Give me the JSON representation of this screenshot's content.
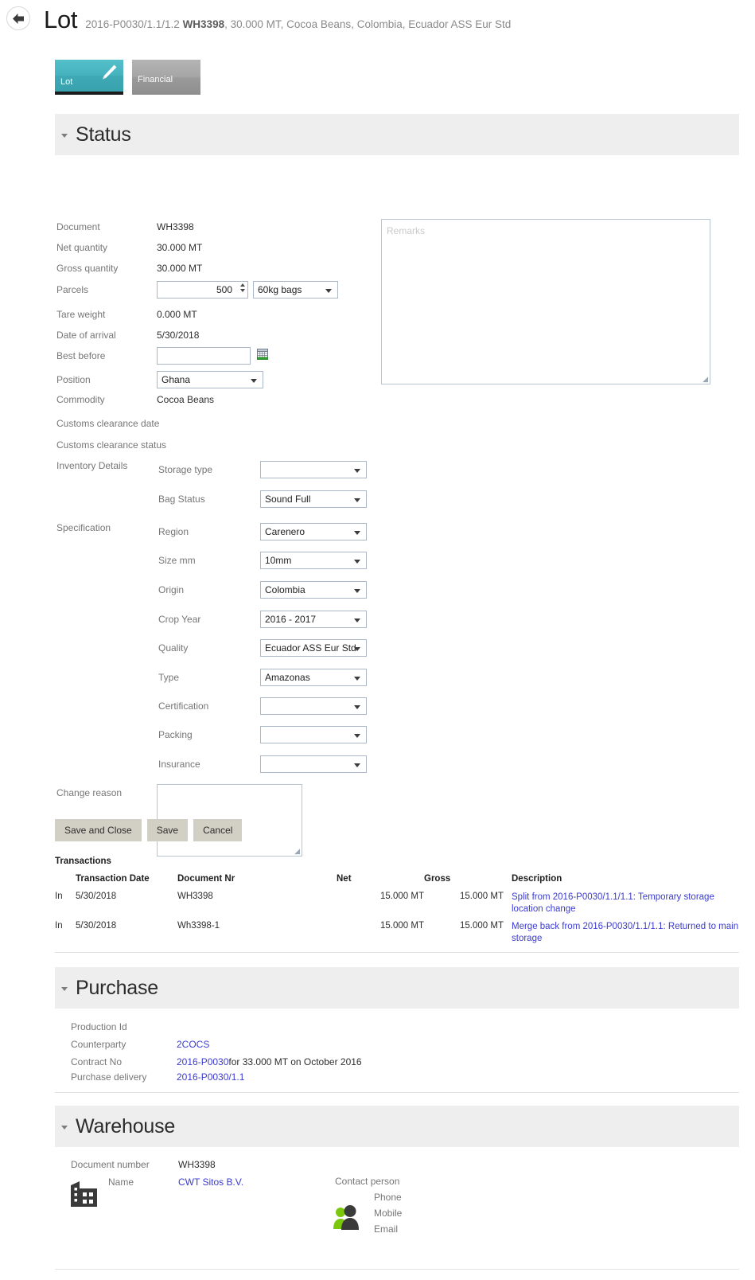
{
  "header": {
    "back_icon": "back-arrow-icon",
    "title": "Lot",
    "subtitle_prefix": "2016-P0030/1.1/1.2 ",
    "subtitle_bold": "WH3398",
    "subtitle_suffix": ", 30.000 MT, Cocoa Beans, Colombia, Ecuador ASS Eur Std"
  },
  "tabs": [
    {
      "label": "Lot",
      "active": true,
      "icon": "pencil-icon",
      "color": "#45b3bf"
    },
    {
      "label": "Financial",
      "active": false,
      "color": "#a0a0a0"
    }
  ],
  "sections": {
    "status": {
      "title": "Status"
    },
    "purchase": {
      "title": "Purchase"
    },
    "warehouse": {
      "title": "Warehouse"
    }
  },
  "status": {
    "document_label": "Document",
    "document_value": "WH3398",
    "net_quantity_label": "Net quantity",
    "net_quantity_value": "30.000 MT",
    "gross_quantity_label": "Gross quantity",
    "gross_quantity_value": "30.000 MT",
    "parcels_label": "Parcels",
    "parcels_value": "500",
    "parcels_unit": "60kg bags",
    "tare_weight_label": "Tare weight",
    "tare_weight_value": "0.000 MT",
    "date_of_arrival_label": "Date of arrival",
    "date_of_arrival_value": "5/30/2018",
    "best_before_label": "Best before",
    "best_before_value": "",
    "position_label": "Position",
    "position_value": "Ghana",
    "commodity_label": "Commodity",
    "commodity_value": "Cocoa Beans",
    "customs_clearance_date_label": "Customs clearance date",
    "customs_clearance_date_value": "",
    "customs_clearance_status_label": "Customs clearance status",
    "customs_clearance_status_value": "",
    "remarks_placeholder": "Remarks",
    "remarks_value": ""
  },
  "inventory_details": {
    "group_label": "Inventory Details",
    "fields": [
      {
        "label": "Storage type",
        "value": ""
      },
      {
        "label": "Bag Status",
        "value": "Sound Full"
      }
    ]
  },
  "specification": {
    "group_label": "Specification",
    "fields": [
      {
        "label": "Region",
        "value": "Carenero"
      },
      {
        "label": "Size mm",
        "value": "10mm"
      },
      {
        "label": "Origin",
        "value": "Colombia"
      },
      {
        "label": "Crop Year",
        "value": "2016 - 2017"
      },
      {
        "label": "Quality",
        "value": "Ecuador ASS Eur Std"
      },
      {
        "label": "Type",
        "value": "Amazonas"
      },
      {
        "label": "Certification",
        "value": ""
      },
      {
        "label": "Packing",
        "value": ""
      },
      {
        "label": "Insurance",
        "value": ""
      }
    ]
  },
  "change_reason": {
    "label": "Change reason",
    "value": ""
  },
  "buttons": {
    "save_and_close": "Save and Close",
    "save": "Save",
    "cancel": "Cancel"
  },
  "transactions": {
    "title": "Transactions",
    "columns": [
      "",
      "Transaction Date",
      "Document Nr",
      "Net",
      "Gross",
      "Description"
    ],
    "rows": [
      {
        "direction": "In",
        "date": "5/30/2018",
        "document": "WH3398",
        "net": "15.000 MT",
        "gross": "15.000 MT",
        "description": "Split from 2016-P0030/1.1/1.1: Temporary storage location change"
      },
      {
        "direction": "In",
        "date": "5/30/2018",
        "document": "Wh3398-1",
        "net": "15.000 MT",
        "gross": "15.000 MT",
        "description": "Merge back from 2016-P0030/1.1/1.1: Returned to main storage"
      }
    ]
  },
  "purchase": {
    "production_id_label": "Production Id",
    "production_id_value": "",
    "counterparty_label": "Counterparty",
    "counterparty_value": "2COCS",
    "contract_no_label": "Contract No",
    "contract_no_link": "2016-P0030",
    "contract_no_rest": " for 33.000 MT on October 2016",
    "purchase_delivery_label": "Purchase delivery",
    "purchase_delivery_value": "2016-P0030/1.1"
  },
  "warehouse": {
    "document_number_label": "Document number",
    "document_number_value": "WH3398",
    "name_label": "Name",
    "name_value": "CWT Sitos B.V.",
    "contact_person_label": "Contact person",
    "contact_person_value": "",
    "phone_label": "Phone",
    "phone_value": "",
    "mobile_label": "Mobile",
    "mobile_value": "",
    "email_label": "Email",
    "email_value": "",
    "building_icon": "building-icon",
    "contact_icon": "contact-person-icon"
  },
  "colors": {
    "accent": "#45b3bf",
    "link": "#3b3bd0",
    "banner_bg": "#eeeeee",
    "button_bg": "#d2d0c4",
    "input_border": "#abb7c4"
  }
}
